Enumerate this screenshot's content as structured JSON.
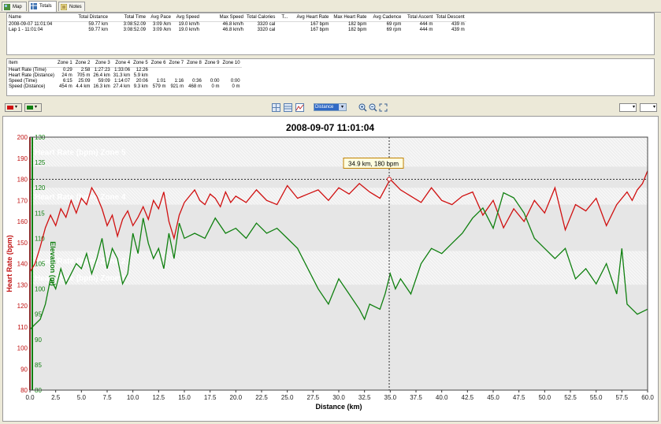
{
  "tabs": [
    {
      "label": "Map",
      "icon": "map-icon"
    },
    {
      "label": "Totals",
      "icon": "table-icon"
    },
    {
      "label": "Notes",
      "icon": "notes-icon"
    }
  ],
  "totals": {
    "headers": [
      "Name",
      "Total Distance",
      "Total Time",
      "Avg Pace",
      "Avg Speed",
      "Max Speed",
      "Total Calories",
      "T...",
      "Avg Heart Rate",
      "Max Heart Rate",
      "Avg Cadence",
      "Total Ascent",
      "Total Descent"
    ],
    "rows": [
      [
        "2008-09-07 11:01:04",
        "59.77 km",
        "3:08:52.09",
        "3:09 /km",
        "19.0 km/h",
        "46.8 km/h",
        "3320 cal",
        "",
        "167 bpm",
        "182 bpm",
        "69 rpm",
        "444 m",
        "439 m"
      ],
      [
        "Lap 1 - 11:01:04",
        "59.77 km",
        "3:08:52.09",
        "3:09 /km",
        "19.0 km/h",
        "46.8 km/h",
        "3320 cal",
        "",
        "167 bpm",
        "182 bpm",
        "69 rpm",
        "444 m",
        "439 m"
      ]
    ]
  },
  "zones": {
    "headers": [
      "Item",
      "Zone 1",
      "Zone 2",
      "Zone 3",
      "Zone 4",
      "Zone 5",
      "Zone 6",
      "Zone 7",
      "Zone 8",
      "Zone 9",
      "Zone 10"
    ],
    "rows": [
      [
        "Heart Rate (Time)",
        "0:29",
        "2:58",
        "1:27:23",
        "1:33:06",
        "12:26",
        "",
        "",
        "",
        "",
        ""
      ],
      [
        "Heart Rate (Distance)",
        "24 m",
        "705 m",
        "26.4 km",
        "31.3 km",
        "5.9 km",
        "",
        "",
        "",
        "",
        ""
      ],
      [
        "Speed (Time)",
        "6:15",
        "25:09",
        "59:09",
        "1:14:07",
        "20:06",
        "1:01",
        "1:16",
        "0:36",
        "0:00",
        "0:00"
      ],
      [
        "Speed (Distance)",
        "454 m",
        "4.4 km",
        "16.3 km",
        "27.4 km",
        "9.3 km",
        "579 m",
        "921 m",
        "468 m",
        "0 m",
        "0 m"
      ]
    ]
  },
  "toolbar": {
    "xaxis_select": "Distance"
  },
  "colors": {
    "heart": "#d01010",
    "elev": "#108010"
  },
  "chart_data": {
    "type": "line",
    "title": "2008-09-07 11:01:04",
    "xlabel": "Distance (km)",
    "xlim": [
      0,
      60
    ],
    "xticks": [
      "0.0",
      "2.5",
      "5.0",
      "7.5",
      "10.0",
      "12.5",
      "15.0",
      "17.5",
      "20.0",
      "22.5",
      "25.0",
      "27.5",
      "30.0",
      "32.5",
      "35.0",
      "37.5",
      "40.0",
      "42.5",
      "45.0",
      "47.5",
      "50.0",
      "52.5",
      "55.0",
      "57.5",
      "60.0"
    ],
    "y1label": "Heart Rate (bpm)",
    "y1lim": [
      80,
      200
    ],
    "y1ticks": [
      "80",
      "90",
      "100",
      "110",
      "120",
      "130",
      "140",
      "150",
      "160",
      "170",
      "180",
      "190",
      "200"
    ],
    "y2label": "Elevation (m)",
    "y2lim": [
      80,
      130
    ],
    "y2ticks": [
      "80",
      "85",
      "90",
      "95",
      "100",
      "105",
      "110",
      "115",
      "120",
      "125",
      "130"
    ],
    "zones": [
      {
        "label": "Heart Rate (bpm) Zone 5",
        "from": 186,
        "to": 200
      },
      {
        "label": "Heart Rate (bpm) Zone 4",
        "from": 168,
        "to": 176
      },
      {
        "label": "Heart Rate (bpm) Zone 2",
        "from": 137,
        "to": 146
      },
      {
        "label": "Heart Rate (bpm) Zone 1",
        "from": 130,
        "to": 137
      }
    ],
    "tooltip": "34.9 km, 180 bpm",
    "cursor": {
      "x": 34.9,
      "y": 180
    },
    "series": [
      {
        "name": "Heart Rate",
        "axis": "y1",
        "x": [
          0,
          0.5,
          1,
          1.5,
          2,
          2.5,
          3,
          3.5,
          4,
          4.5,
          5,
          5.5,
          6,
          6.5,
          7,
          7.5,
          8,
          8.5,
          9,
          9.5,
          10,
          10.5,
          11,
          11.5,
          12,
          12.5,
          13,
          13.5,
          14,
          14.5,
          15,
          15.5,
          16,
          16.5,
          17,
          17.5,
          18,
          18.5,
          19,
          19.5,
          20,
          21,
          22,
          23,
          24,
          25,
          26,
          27,
          28,
          29,
          30,
          31,
          32,
          33,
          34,
          35,
          36,
          37,
          38,
          39,
          40,
          41,
          42,
          43,
          44,
          45,
          46,
          47,
          48,
          49,
          50,
          51,
          52,
          53,
          54,
          55,
          56,
          57,
          58,
          58.5,
          59,
          59.5,
          60
        ],
        "values": [
          136,
          140,
          148,
          157,
          163,
          158,
          166,
          162,
          170,
          164,
          171,
          168,
          176,
          172,
          166,
          158,
          163,
          153,
          161,
          165,
          158,
          162,
          167,
          161,
          170,
          166,
          174,
          160,
          152,
          163,
          169,
          172,
          175,
          170,
          168,
          173,
          171,
          167,
          174,
          169,
          172,
          169,
          175,
          170,
          168,
          177,
          171,
          173,
          175,
          170,
          176,
          173,
          178,
          174,
          171,
          180,
          175,
          172,
          169,
          176,
          170,
          168,
          172,
          174,
          163,
          170,
          157,
          166,
          160,
          170,
          164,
          176,
          156,
          168,
          165,
          171,
          158,
          168,
          174,
          170,
          175,
          178,
          184
        ]
      },
      {
        "name": "Elevation",
        "axis": "y2",
        "x": [
          0,
          0.5,
          1,
          1.5,
          2,
          2.5,
          3,
          3.5,
          4,
          4.5,
          5,
          5.5,
          6,
          6.5,
          7,
          7.5,
          8,
          8.5,
          9,
          9.5,
          10,
          10.5,
          11,
          11.5,
          12,
          12.5,
          13,
          13.5,
          14,
          14.5,
          15,
          16,
          17,
          18,
          19,
          20,
          21,
          22,
          23,
          24,
          25,
          26,
          27,
          28,
          29,
          30,
          31,
          32,
          32.5,
          33,
          34,
          34.5,
          35,
          35.5,
          36,
          37,
          38,
          39,
          40,
          41,
          42,
          43,
          44,
          45,
          46,
          47,
          48,
          49,
          50,
          51,
          52,
          53,
          54,
          55,
          56,
          57,
          57.5,
          58,
          58.5,
          59,
          60
        ],
        "values": [
          92,
          93,
          94,
          97,
          102,
          100,
          104,
          101,
          103,
          105,
          104,
          107,
          103,
          106,
          110,
          104,
          108,
          106,
          101,
          103,
          111,
          107,
          114,
          109,
          106,
          108,
          104,
          111,
          106,
          113,
          110,
          111,
          110,
          114,
          111,
          112,
          110,
          113,
          111,
          112,
          110,
          108,
          104,
          100,
          97,
          102,
          99,
          96,
          94,
          97,
          96,
          99,
          103,
          100,
          102,
          99,
          105,
          108,
          107,
          109,
          111,
          114,
          116,
          112,
          119,
          118,
          115,
          110,
          108,
          106,
          108,
          102,
          104,
          101,
          105,
          99,
          108,
          97,
          96,
          95,
          96
        ]
      }
    ]
  }
}
